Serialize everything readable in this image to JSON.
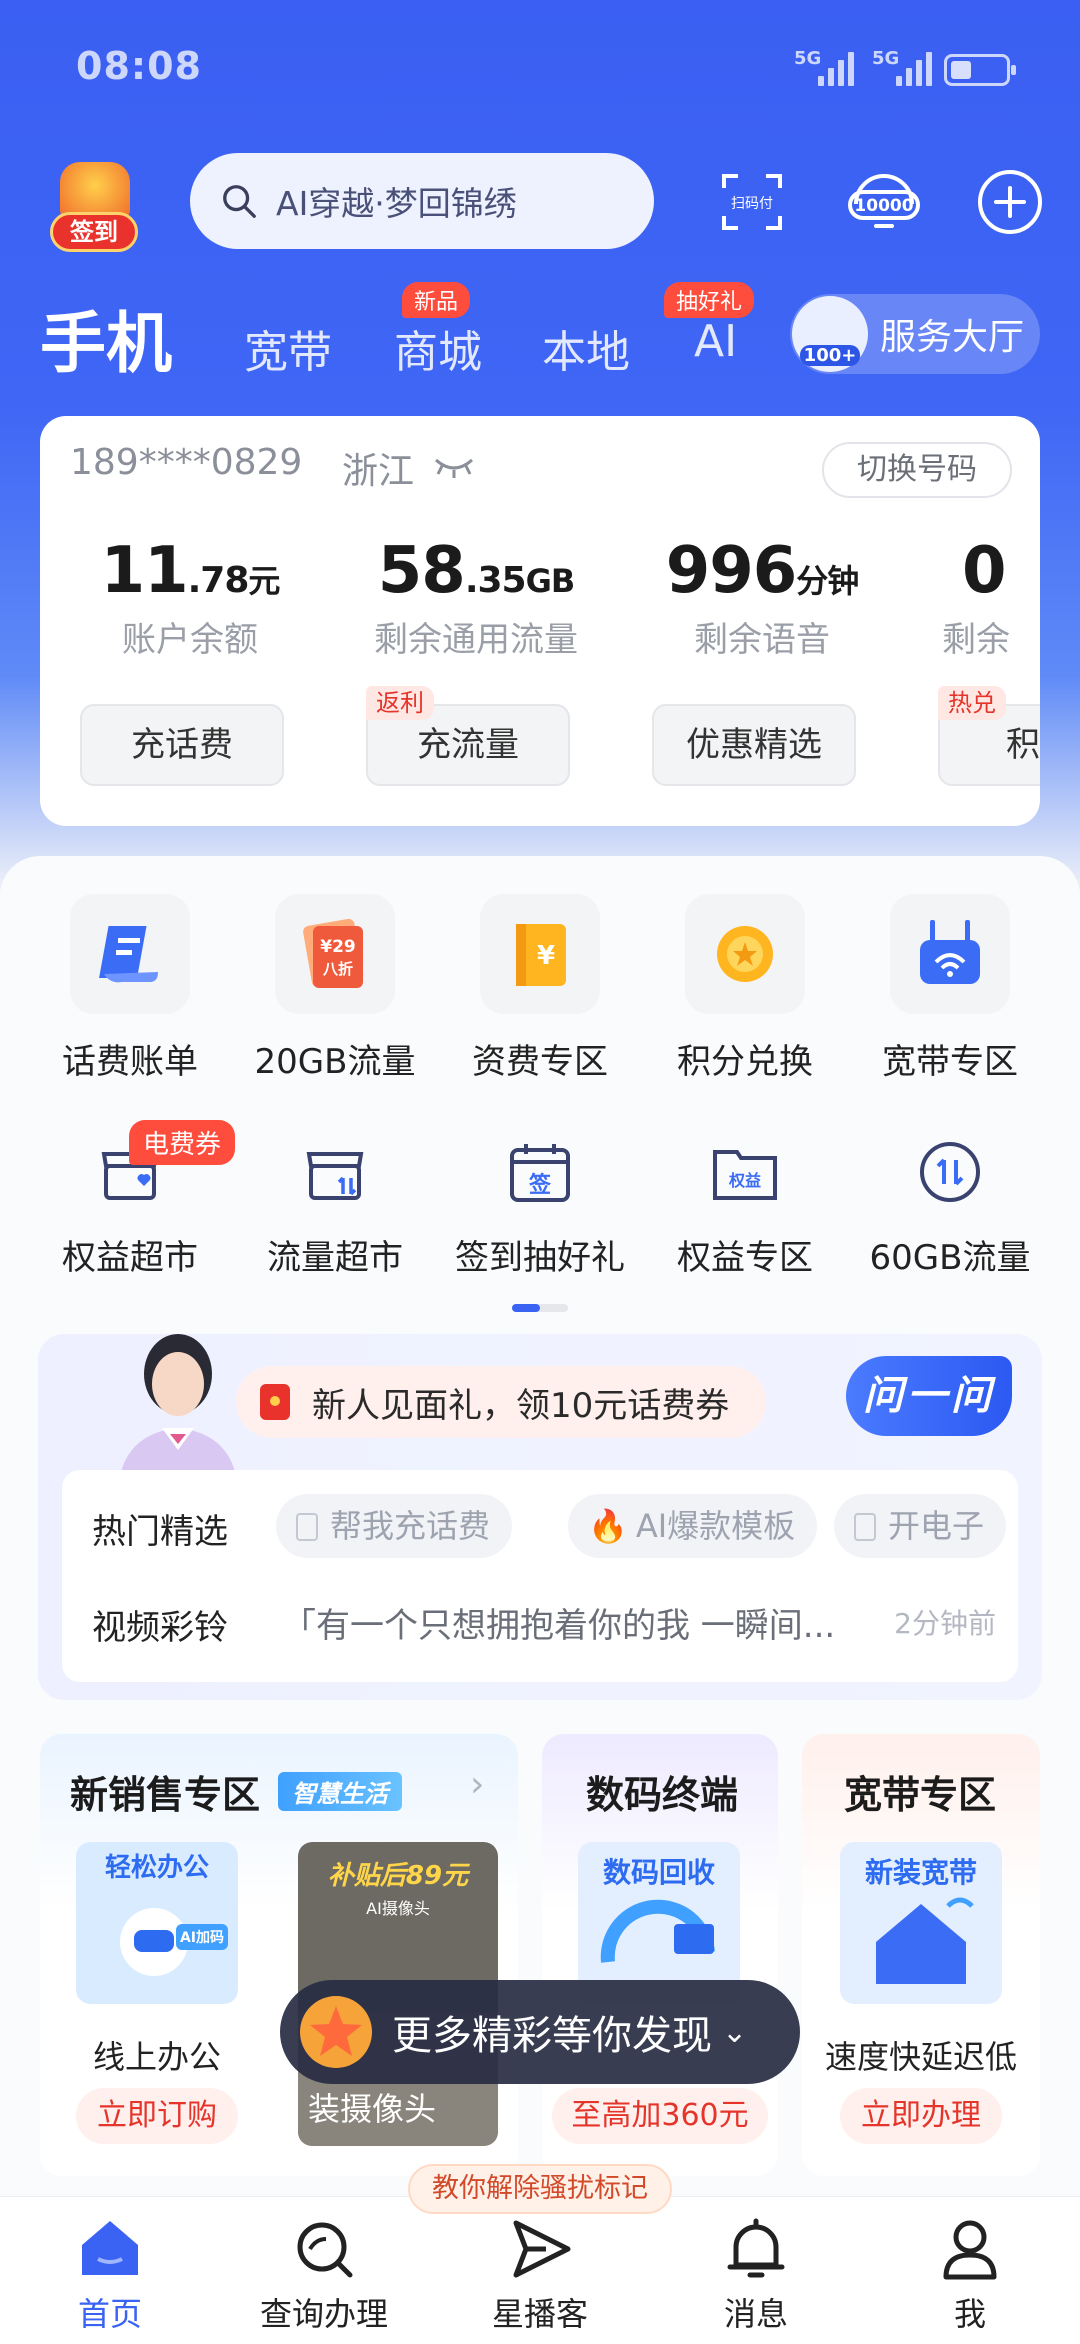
{
  "status": {
    "time": "08:08",
    "net1": "5G",
    "net2": "5G",
    "battery_level": 0.35
  },
  "topbar": {
    "checkin_label": "签到",
    "search_placeholder": "AI穿越·梦回锦绣",
    "scan_label": "扫码付",
    "hotline_label": "10000"
  },
  "nav": {
    "tabs": [
      {
        "label": "手机",
        "badge": ""
      },
      {
        "label": "宽带",
        "badge": ""
      },
      {
        "label": "商城",
        "badge": "新品"
      },
      {
        "label": "本地",
        "badge": ""
      },
      {
        "label": "AI",
        "badge": "抽好礼"
      }
    ],
    "service_hall": {
      "badge": "100+",
      "label": "服务大厅"
    }
  },
  "account": {
    "phone": "189****0829",
    "province": "浙江",
    "switch_label": "切换号码",
    "stats": [
      {
        "big": "11",
        "small": ".78",
        "unit": "元",
        "caption": "账户余额"
      },
      {
        "big": "58",
        "small": ".35",
        "unit": "GB",
        "caption": "剩余通用流量"
      },
      {
        "big": "996",
        "small": "",
        "unit": "分钟",
        "caption": "剩余语音"
      },
      {
        "big": "0",
        "small": "",
        "unit": "",
        "caption": "剩余"
      }
    ],
    "buttons": [
      {
        "label": "充话费",
        "tag": ""
      },
      {
        "label": "充流量",
        "tag": "返利"
      },
      {
        "label": "优惠精选",
        "tag": ""
      },
      {
        "label": "积分",
        "tag": "热兑"
      }
    ]
  },
  "grid_row1": [
    {
      "label": "话费账单",
      "icon": "bill-icon"
    },
    {
      "label": "20GB流量",
      "icon": "discount-icon",
      "art": "¥29",
      "art2": "八折"
    },
    {
      "label": "资费专区",
      "icon": "tariff-book-icon"
    },
    {
      "label": "积分兑换",
      "icon": "points-coin-icon"
    },
    {
      "label": "宽带专区",
      "icon": "router-icon"
    }
  ],
  "grid_row2": [
    {
      "label": "权益超市",
      "icon": "store-heart-icon",
      "badge": "电费券"
    },
    {
      "label": "流量超市",
      "icon": "store-flow-icon"
    },
    {
      "label": "签到抽好礼",
      "icon": "calendar-sign-icon",
      "art": "签"
    },
    {
      "label": "权益专区",
      "icon": "rights-folder-icon",
      "art": "权益"
    },
    {
      "label": "60GB流量",
      "icon": "flow-arrows-icon"
    }
  ],
  "ai_card": {
    "promo": "新人见面礼，领10元话费券",
    "ask_label": "问一问",
    "hot_label": "热门精选",
    "chips": [
      "帮我充话费",
      "AI爆款模板",
      "开电子"
    ],
    "ringtone_label": "视频彩铃",
    "lyric": "「有一个只想拥抱着你的我 一瞬间...",
    "ago": "2分钟前"
  },
  "zones": {
    "sales": {
      "title": "新销售专区",
      "tag": "智慧生活",
      "item1_art": "轻松办公",
      "item1_art2": "AI加码",
      "item1": "线上办公",
      "item1_btn": "立即订购",
      "item2_art": "补贴后89元",
      "item2_art2": "AI摄像头",
      "item2": "装摄像头"
    },
    "digital": {
      "title": "数码终端",
      "art": "数码回收",
      "btn": "至高加360元"
    },
    "broadband": {
      "title": "宽带专区",
      "art": "新装宽带",
      "cap": "速度快延迟低",
      "btn": "立即办理"
    }
  },
  "float_banner": "更多精彩等你发现",
  "tooltip": "教你解除骚扰标记",
  "tabbar": [
    {
      "label": "首页",
      "icon": "home-icon"
    },
    {
      "label": "查询办理",
      "icon": "search-query-icon"
    },
    {
      "label": "星播客",
      "icon": "paper-plane-icon"
    },
    {
      "label": "消息",
      "icon": "bell-icon"
    },
    {
      "label": "我",
      "icon": "profile-icon"
    }
  ],
  "colors": {
    "brand": "#3a63f3",
    "accent_red": "#e5352b"
  }
}
